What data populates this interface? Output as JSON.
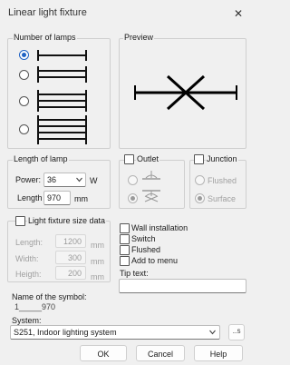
{
  "window": {
    "title": "Linear light fixture",
    "close_glyph": "✕"
  },
  "lamps_group": {
    "label": "Number of lamps",
    "options": [
      1,
      2,
      3,
      4
    ],
    "selected": 1
  },
  "preview_group": {
    "label": "Preview"
  },
  "length_group": {
    "label": "Length of lamp",
    "power_label": "Power:",
    "power_value": "36",
    "power_unit": "W",
    "length_label": "Length",
    "length_value": "970",
    "length_unit": "mm"
  },
  "outlet_group": {
    "label": "Outlet"
  },
  "junction_group": {
    "label": "Junction",
    "options": [
      "Flushed",
      "Surface"
    ],
    "selected": "Surface"
  },
  "size_group": {
    "label": "Light fixture size data",
    "rows": [
      {
        "label": "Length:",
        "value": "1200",
        "unit": "mm"
      },
      {
        "label": "Width:",
        "value": "300",
        "unit": "mm"
      },
      {
        "label": "Heigth:",
        "value": "200",
        "unit": "mm"
      }
    ]
  },
  "options": {
    "wall_installation": "Wall installation",
    "switch": "Switch",
    "flushed": "Flushed",
    "add_to_menu": "Add to menu"
  },
  "tip": {
    "label": "Tip text:",
    "value": ""
  },
  "symbol": {
    "label": "Name of the symbol:",
    "value": "1_____970"
  },
  "system": {
    "label": "System:",
    "value": "S251, Indoor lighting system",
    "side_button": "...S"
  },
  "buttons": {
    "ok": "OK",
    "cancel": "Cancel",
    "help": "Help"
  },
  "colors": {
    "accent": "#1f62c4",
    "background": "#f0f0f0"
  }
}
